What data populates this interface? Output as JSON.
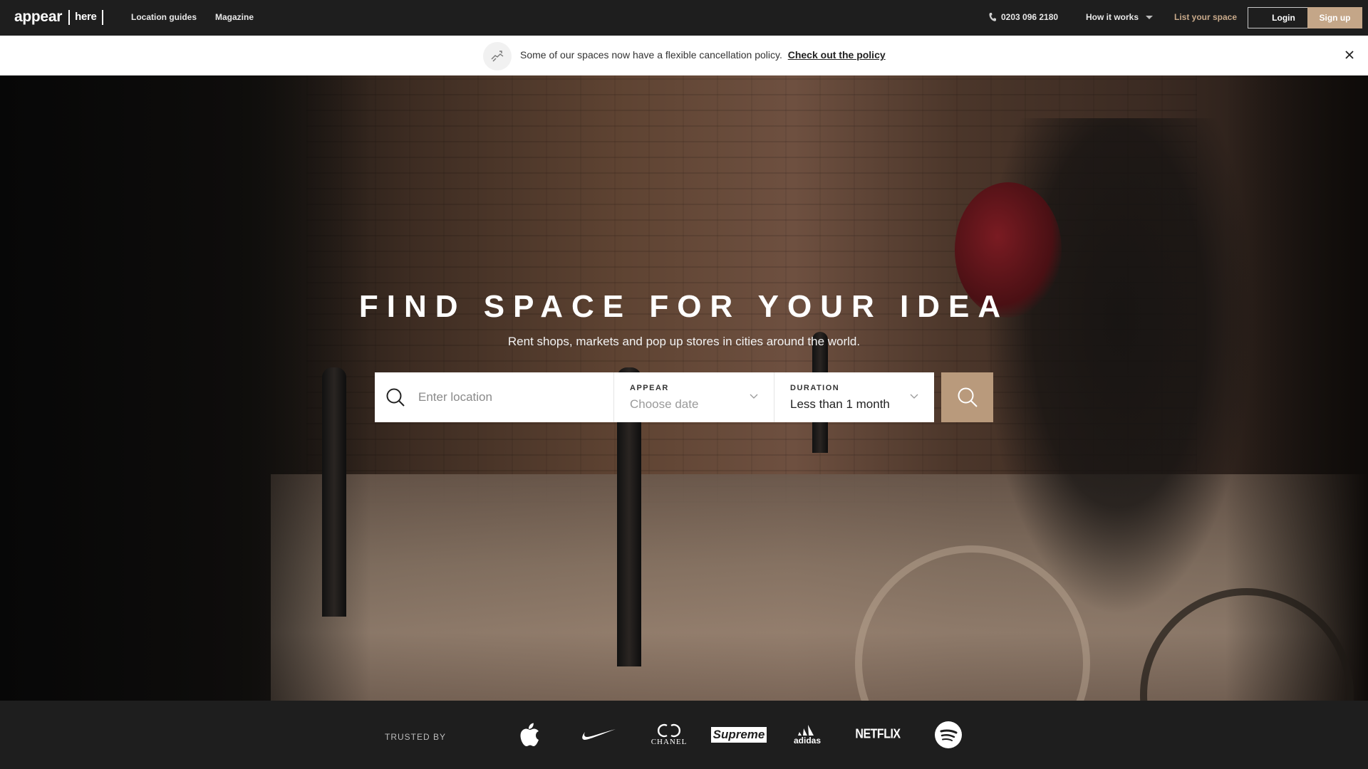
{
  "nav": {
    "logo_main": "appear",
    "logo_bracket": "here",
    "links": [
      "Location guides",
      "Magazine"
    ],
    "phone": "0203 096 2180",
    "how_it_works": "How it works",
    "list_your_space": "List your space",
    "login": "Login",
    "signup": "Sign up"
  },
  "banner": {
    "text": "Some of our spaces now have a flexible cancellation policy.",
    "link": "Check out the policy"
  },
  "hero": {
    "title": "FIND SPACE FOR YOUR IDEA",
    "subtitle": "Rent shops, markets and pop up stores in cities around the world."
  },
  "search": {
    "location_placeholder": "Enter location",
    "appear_label": "APPEAR",
    "appear_value": "Choose date",
    "duration_label": "DURATION",
    "duration_value": "Less than 1 month"
  },
  "trusted": {
    "label": "TRUSTED BY",
    "brands": [
      "apple-logo",
      "nike-logo",
      "CHANEL",
      "Supreme",
      "adidas",
      "NETFLIX",
      "spotify-logo"
    ]
  },
  "colors": {
    "nav_bg": "#1e1e1e",
    "accent": "#c4a688",
    "search_button": "#b99a7c",
    "list_space_text": "#c8a98a"
  }
}
